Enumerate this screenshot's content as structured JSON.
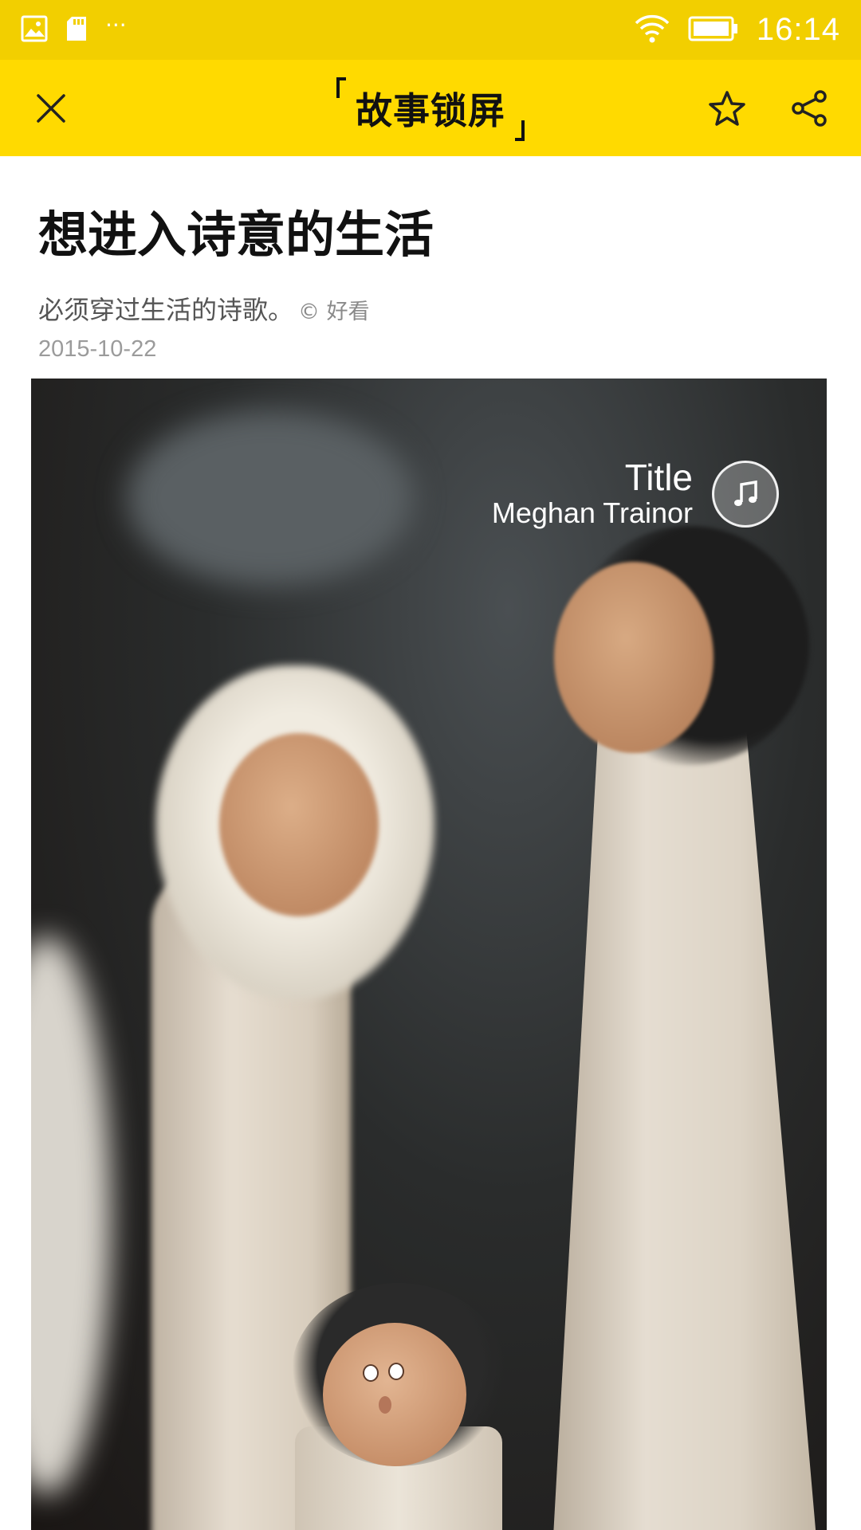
{
  "status_bar": {
    "time": "16:14",
    "left_icons": [
      "image-icon",
      "sd-card-icon",
      "more-dots-icon"
    ],
    "more_dots": "···",
    "right_icons": [
      "wifi-icon",
      "battery-icon"
    ]
  },
  "toolbar": {
    "brand": "故事锁屏",
    "close_icon": "close-icon",
    "favorite_icon": "star-icon",
    "share_icon": "share-icon"
  },
  "article": {
    "title": "想进入诗意的生活",
    "subtitle": "必须穿过生活的诗歌。",
    "credit": "© 好看",
    "date": "2015-10-22"
  },
  "music": {
    "title": "Title",
    "artist": "Meghan Trainor",
    "icon": "music-note-icon"
  },
  "colors": {
    "status_bar": "#F2CF00",
    "toolbar": "#FFDA00"
  }
}
